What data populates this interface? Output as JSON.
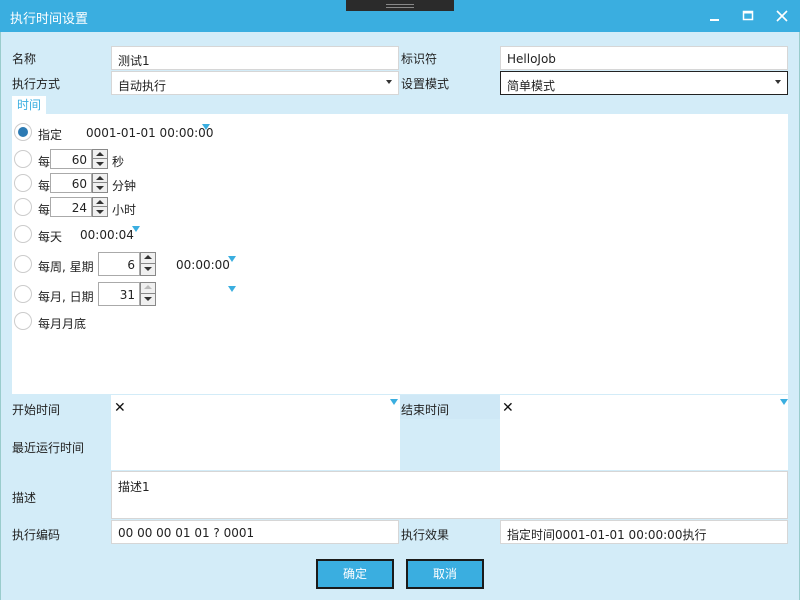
{
  "window": {
    "title": "执行时间设置"
  },
  "form": {
    "name_label": "名称",
    "name_value": "测试1",
    "identifier_label": "标识符",
    "identifier_value": "HelloJob",
    "exec_mode_label": "执行方式",
    "exec_mode_value": "自动执行",
    "setting_mode_label": "设置模式",
    "setting_mode_value": "简单模式"
  },
  "time_tab": {
    "label": "时间",
    "specify_label": "指定",
    "specify_value": "0001-01-01 00:00:00",
    "every_label": "每",
    "seconds_value": "60",
    "seconds_unit": "秒",
    "minutes_value": "60",
    "minutes_unit": "分钟",
    "hours_value": "24",
    "hours_unit": "小时",
    "daily_label": "每天",
    "daily_value": "00:00:04",
    "weekly_label": "每周, 星期",
    "weekly_day": "6",
    "weekly_time": "00:00:00",
    "monthly_label": "每月, 日期",
    "monthly_day": "31",
    "month_end_label": "每月月底"
  },
  "schedule": {
    "start_label": "开始时间",
    "start_value": "✕",
    "end_label": "结束时间",
    "end_value": "✕",
    "recent_label": "最近运行时间"
  },
  "desc": {
    "label": "描述",
    "value": "描述1"
  },
  "code": {
    "label": "执行编码",
    "value": "00 00 00 01 01 ? 0001"
  },
  "effect": {
    "label": "执行效果",
    "value": "指定时间0001-01-01 00:00:00执行"
  },
  "buttons": {
    "ok": "确定",
    "cancel": "取消"
  },
  "colors": {
    "accent": "#3aaee0",
    "background": "#d3ecf8",
    "radio_selected": "#2c7ab3"
  }
}
